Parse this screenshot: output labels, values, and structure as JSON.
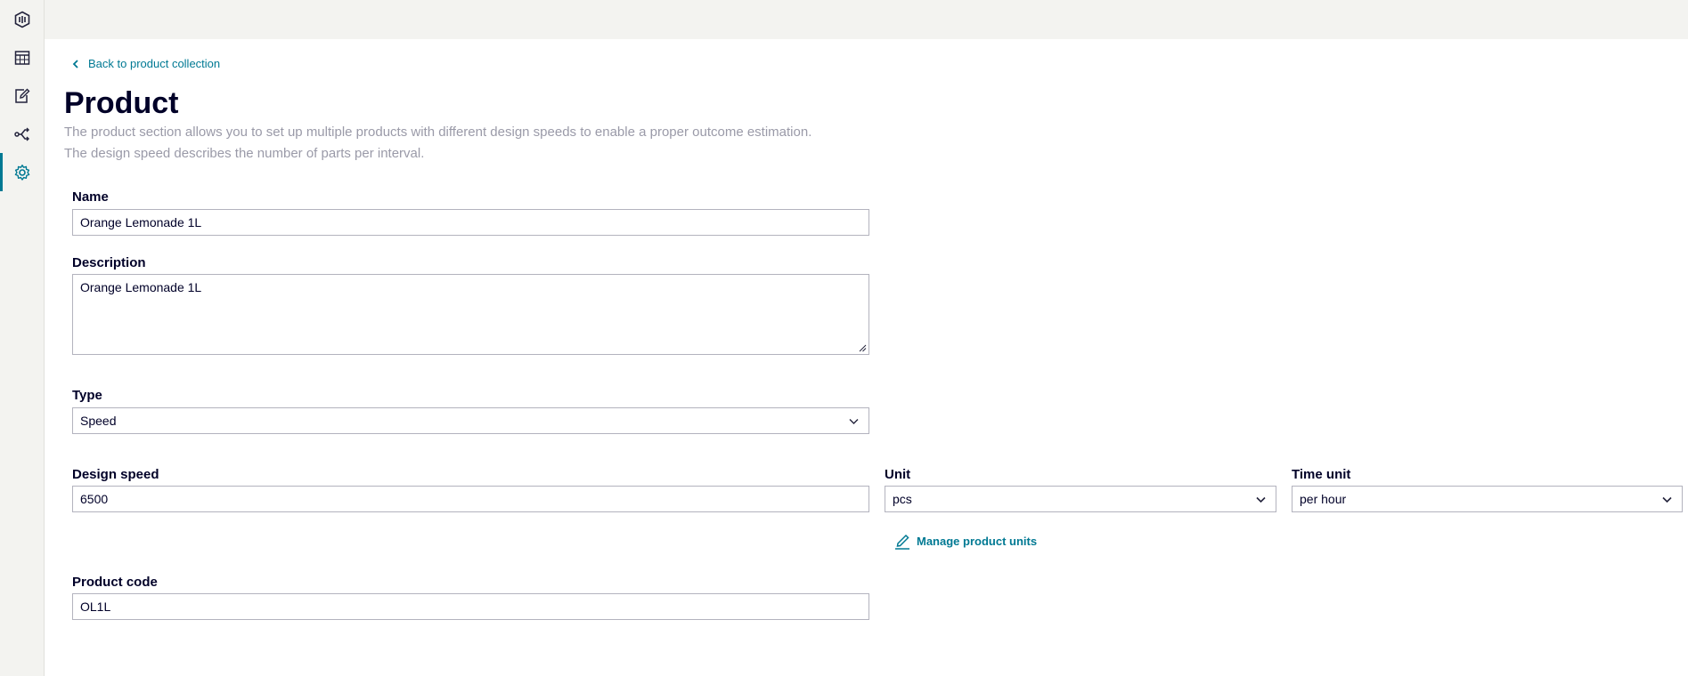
{
  "sidebar": {
    "items": [
      {
        "icon": "app-logo-icon"
      },
      {
        "icon": "calendar-icon"
      },
      {
        "icon": "edit-note-icon"
      },
      {
        "icon": "flow-icon"
      },
      {
        "icon": "settings-icon",
        "active": true
      }
    ]
  },
  "header": {
    "back_label": "Back to product collection",
    "title": "Product",
    "intro_line1": "The product section allows you to set up multiple products with different design speeds to enable a proper outcome estimation.",
    "intro_line2": "The design speed describes the number of parts per interval."
  },
  "form": {
    "name": {
      "label": "Name",
      "value": "Orange Lemonade 1L"
    },
    "description": {
      "label": "Description",
      "value": "Orange Lemonade 1L"
    },
    "type": {
      "label": "Type",
      "value": "Speed"
    },
    "design_speed": {
      "label": "Design speed",
      "value": "6500"
    },
    "unit": {
      "label": "Unit",
      "value": "pcs"
    },
    "time_unit": {
      "label": "Time unit",
      "value": "per hour"
    },
    "manage_units_label": "Manage product units",
    "product_code": {
      "label": "Product code",
      "value": "OL1L"
    }
  },
  "colors": {
    "accent": "#007993",
    "text": "#000028",
    "muted": "#9a9aa8",
    "border": "#b3b3be",
    "chrome": "#f3f3f0"
  }
}
